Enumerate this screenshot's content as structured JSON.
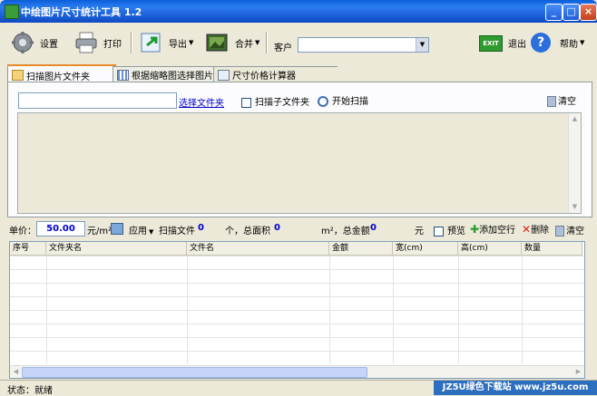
{
  "window": {
    "title": "中绘图片尺寸统计工具 1.2",
    "minimize": "_",
    "maximize": "□",
    "close": "×"
  },
  "toolbar": {
    "settings": "设置",
    "print": "打印",
    "export": "导出",
    "merge": "合并",
    "customer_label": "客户",
    "customer_value": "",
    "exit": "退出",
    "help": "帮助",
    "exit_icon_text": "EXIT",
    "help_icon_text": "?"
  },
  "tabs": [
    {
      "label": "扫描图片文件夹",
      "active": true
    },
    {
      "label": "根据缩略图选择图片",
      "active": false
    },
    {
      "label": "尺寸价格计算器",
      "active": false
    }
  ],
  "scan_panel": {
    "folder_path": "",
    "choose_folder": "选择文件夹",
    "scan_subfolders": "扫描子文件夹",
    "start_scan": "开始扫描",
    "clear": "清空"
  },
  "price_bar": {
    "unit_price_label": "单价：",
    "unit_price_value": "50.00",
    "unit": "元/m²",
    "apply": "应用",
    "scanned_files_label": "扫描文件",
    "scanned_files_count": "0",
    "count_unit_total_area": "个，总面积",
    "total_area": "0",
    "area_unit_total_amount": "m²，总金额",
    "total_amount": "0",
    "currency": "元",
    "preview": "预览",
    "add_row": "添加空行",
    "delete": "删除",
    "clear": "清空"
  },
  "grid": {
    "columns": [
      "序号",
      "文件夹名",
      "文件名",
      "金额",
      "宽(cm)",
      "高(cm)",
      "数量"
    ]
  },
  "statusbar": {
    "status": "状态：就绪",
    "watermark": "JZ5U绿色下载站 www.jz5u.com"
  },
  "colors": {
    "titlebar": "#0a5fd8",
    "face": "#ece9d8",
    "link": "#0000cc",
    "active_tab_accent": "#e68b2c"
  }
}
